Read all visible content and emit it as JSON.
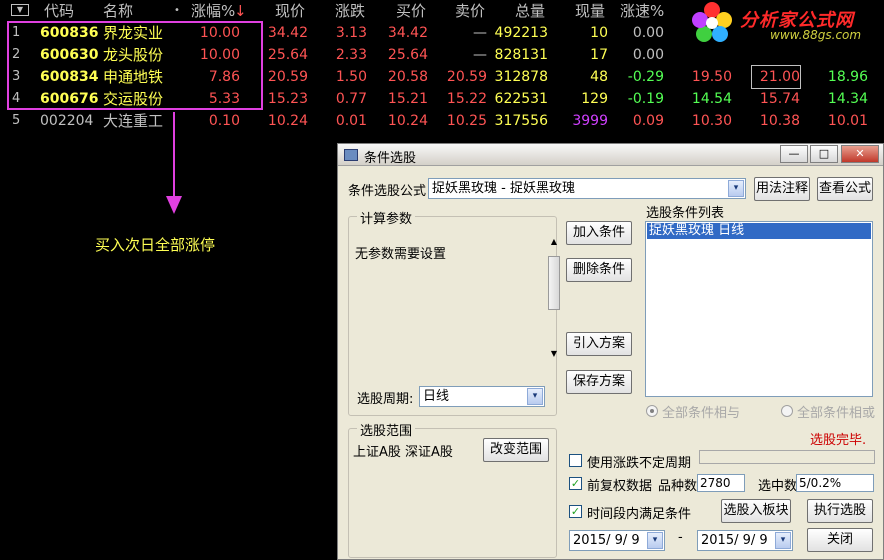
{
  "table": {
    "sort_arrow": "▼",
    "headers": {
      "code": "代码",
      "name": "名称",
      "dot": "•",
      "change_pct": "涨幅%",
      "sort_indicator": "↓",
      "price": "现价",
      "change": "涨跌",
      "bid": "买价",
      "ask": "卖价",
      "volume": "总量",
      "current": "现量",
      "speed": "涨速%"
    },
    "rows": [
      {
        "idx": "1",
        "code": "600836",
        "name": "界龙实业",
        "chg_pct": "10.00",
        "price": "34.42",
        "change": "3.13",
        "bid": "34.42",
        "ask": "—",
        "volume": "492213",
        "cur": "10",
        "speed": "0.00",
        "e1": "",
        "e2": "",
        "e3": ""
      },
      {
        "idx": "2",
        "code": "600630",
        "name": "龙头股份",
        "chg_pct": "10.00",
        "price": "25.64",
        "change": "2.33",
        "bid": "25.64",
        "ask": "—",
        "volume": "828131",
        "cur": "17",
        "speed": "0.00",
        "e1": "",
        "e2": "",
        "e3": ""
      },
      {
        "idx": "3",
        "code": "600834",
        "name": "申通地铁",
        "chg_pct": "7.86",
        "price": "20.59",
        "change": "1.50",
        "bid": "20.58",
        "ask": "20.59",
        "volume": "312878",
        "cur": "48",
        "speed": "-0.29",
        "e1": "19.50",
        "e2": "21.00",
        "e3": "18.96"
      },
      {
        "idx": "4",
        "code": "600676",
        "name": "交运股份",
        "chg_pct": "5.33",
        "price": "15.23",
        "change": "0.77",
        "bid": "15.21",
        "ask": "15.22",
        "volume": "622531",
        "cur": "129",
        "speed": "-0.19",
        "e1": "14.54",
        "e2": "15.74",
        "e3": "14.34"
      },
      {
        "idx": "5",
        "code": "002204",
        "name": "大连重工",
        "chg_pct": "0.10",
        "price": "10.24",
        "change": "0.01",
        "bid": "10.24",
        "ask": "10.25",
        "volume": "317556",
        "cur": "3999",
        "speed": "0.09",
        "e1": "10.30",
        "e2": "10.38",
        "e3": "10.01"
      }
    ]
  },
  "logo": {
    "brand": "分析家公式网",
    "url": "www.88gs.com"
  },
  "annotation": "买入次日全部涨停",
  "dialog": {
    "title": "条件选股",
    "min": "—",
    "max": "□",
    "close": "✕",
    "formula_label": "条件选股公式",
    "formula_value": "捉妖黑玫瑰  - 捉妖黑玫瑰",
    "usage_btn": "用法注释",
    "view_btn": "查看公式",
    "params_group": "计算参数",
    "params_text": "无参数需要设置",
    "period_label": "选股周期:",
    "period_value": "日线",
    "add_btn": "加入条件",
    "del_btn": "删除条件",
    "import_btn": "引入方案",
    "save_btn": "保存方案",
    "list_title": "选股条件列表",
    "list_item": "捉妖黑玫瑰  日线",
    "radio_and": "全部条件相与",
    "radio_or": "全部条件相或",
    "status": "选股完毕.",
    "scope_group": "选股范围",
    "scope_text": "上证A股 深证A股",
    "scope_btn": "改变范围",
    "chk_period": "使用涨跌不定周期",
    "chk_adjust": "前复权数据",
    "count_label": "品种数",
    "count_value": "2780",
    "hits_label": "选中数",
    "hits_value": "5/0.2%",
    "chk_range": "时间段内满足条件",
    "to_block_btn": "选股入板块",
    "exec_btn": "执行选股",
    "date_from": "2015/ 9/ 9",
    "date_sep": "-",
    "date_to": "2015/ 9/ 9",
    "close_btn": "关闭",
    "checkmark": "✓",
    "dd_arrow": "▾",
    "scroll_up": "▲",
    "scroll_down": "▼"
  },
  "colors": {
    "highlight": "#e040e0",
    "price_red": "#ff5454",
    "code_yellow": "#ffff54",
    "status_red": "#cc0000"
  }
}
